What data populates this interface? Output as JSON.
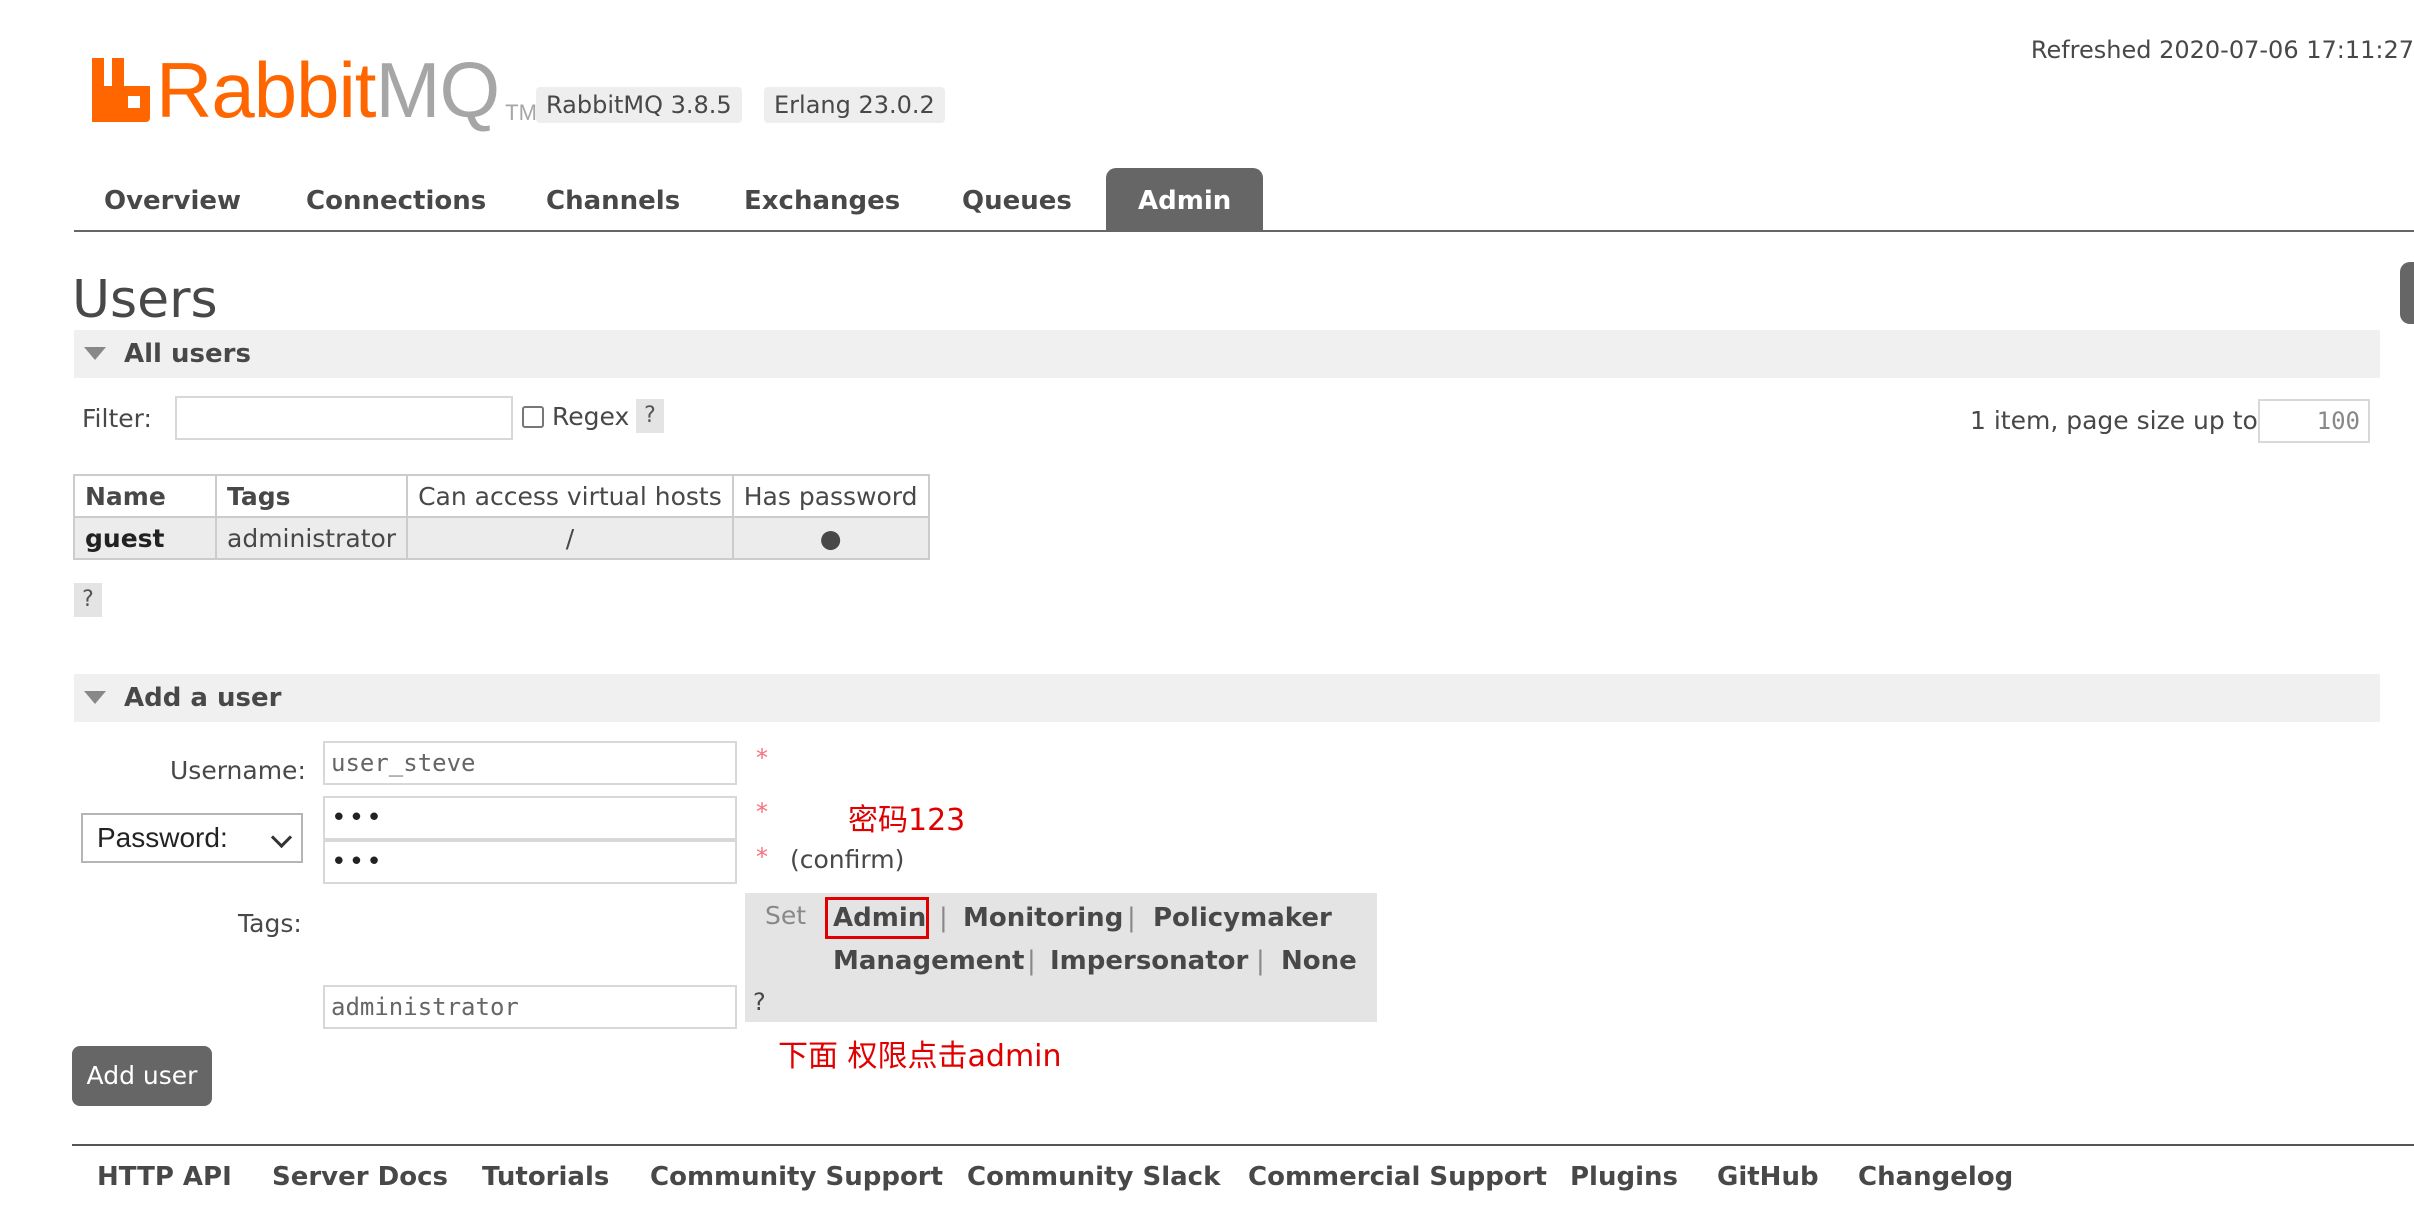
{
  "header": {
    "logo_text_rabbit": "Rabbit",
    "logo_text_mq": "MQ",
    "logo_tm": "TM",
    "rabbitmq_version": "RabbitMQ 3.8.5",
    "erlang_version": "Erlang 23.0.2",
    "refreshed": "Refreshed 2020-07-06 17:11:27"
  },
  "tabs": [
    {
      "label": "Overview",
      "active": false
    },
    {
      "label": "Connections",
      "active": false
    },
    {
      "label": "Channels",
      "active": false
    },
    {
      "label": "Exchanges",
      "active": false
    },
    {
      "label": "Queues",
      "active": false
    },
    {
      "label": "Admin",
      "active": true
    }
  ],
  "page_title": "Users",
  "all_users": {
    "section_label": "All users",
    "filter_label": "Filter:",
    "filter_value": "",
    "regex_label": "Regex",
    "regex_checked": false,
    "help": "?",
    "pagination_text": "1 item, page size up to",
    "page_size": "100",
    "columns": [
      "Name",
      "Tags",
      "Can access virtual hosts",
      "Has password"
    ],
    "rows": [
      {
        "name": "guest",
        "tags": "administrator",
        "vhosts": "/",
        "has_password": "●"
      }
    ],
    "table_help": "?"
  },
  "add_user": {
    "section_label": "Add a user",
    "username_label": "Username:",
    "username_value": "user_steve",
    "password_mode": "Password:",
    "password_value": "•••",
    "confirm_value": "•••",
    "required_mark": "*",
    "confirm_label": "(confirm)",
    "tags_label": "Tags:",
    "tags_value": "administrator",
    "set_label": "Set",
    "tag_options_row1": [
      "Admin",
      "Monitoring",
      "Policymaker"
    ],
    "tag_options_row2": [
      "Management",
      "Impersonator",
      "None"
    ],
    "separator": "|",
    "tags_help": "?",
    "submit_label": "Add user"
  },
  "annotations": {
    "password_note": "密码123",
    "tags_note": "下面 权限点击admin",
    "highlight_color": "#e00000"
  },
  "footer": {
    "links": [
      "HTTP API",
      "Server Docs",
      "Tutorials",
      "Community Support",
      "Community Slack",
      "Commercial Support",
      "Plugins",
      "GitHub",
      "Changelog"
    ]
  },
  "colors": {
    "brand": "#ff6600",
    "tab_active_bg": "#666666",
    "section_bg": "#f0f0f0",
    "required_star": "#f5707a"
  }
}
